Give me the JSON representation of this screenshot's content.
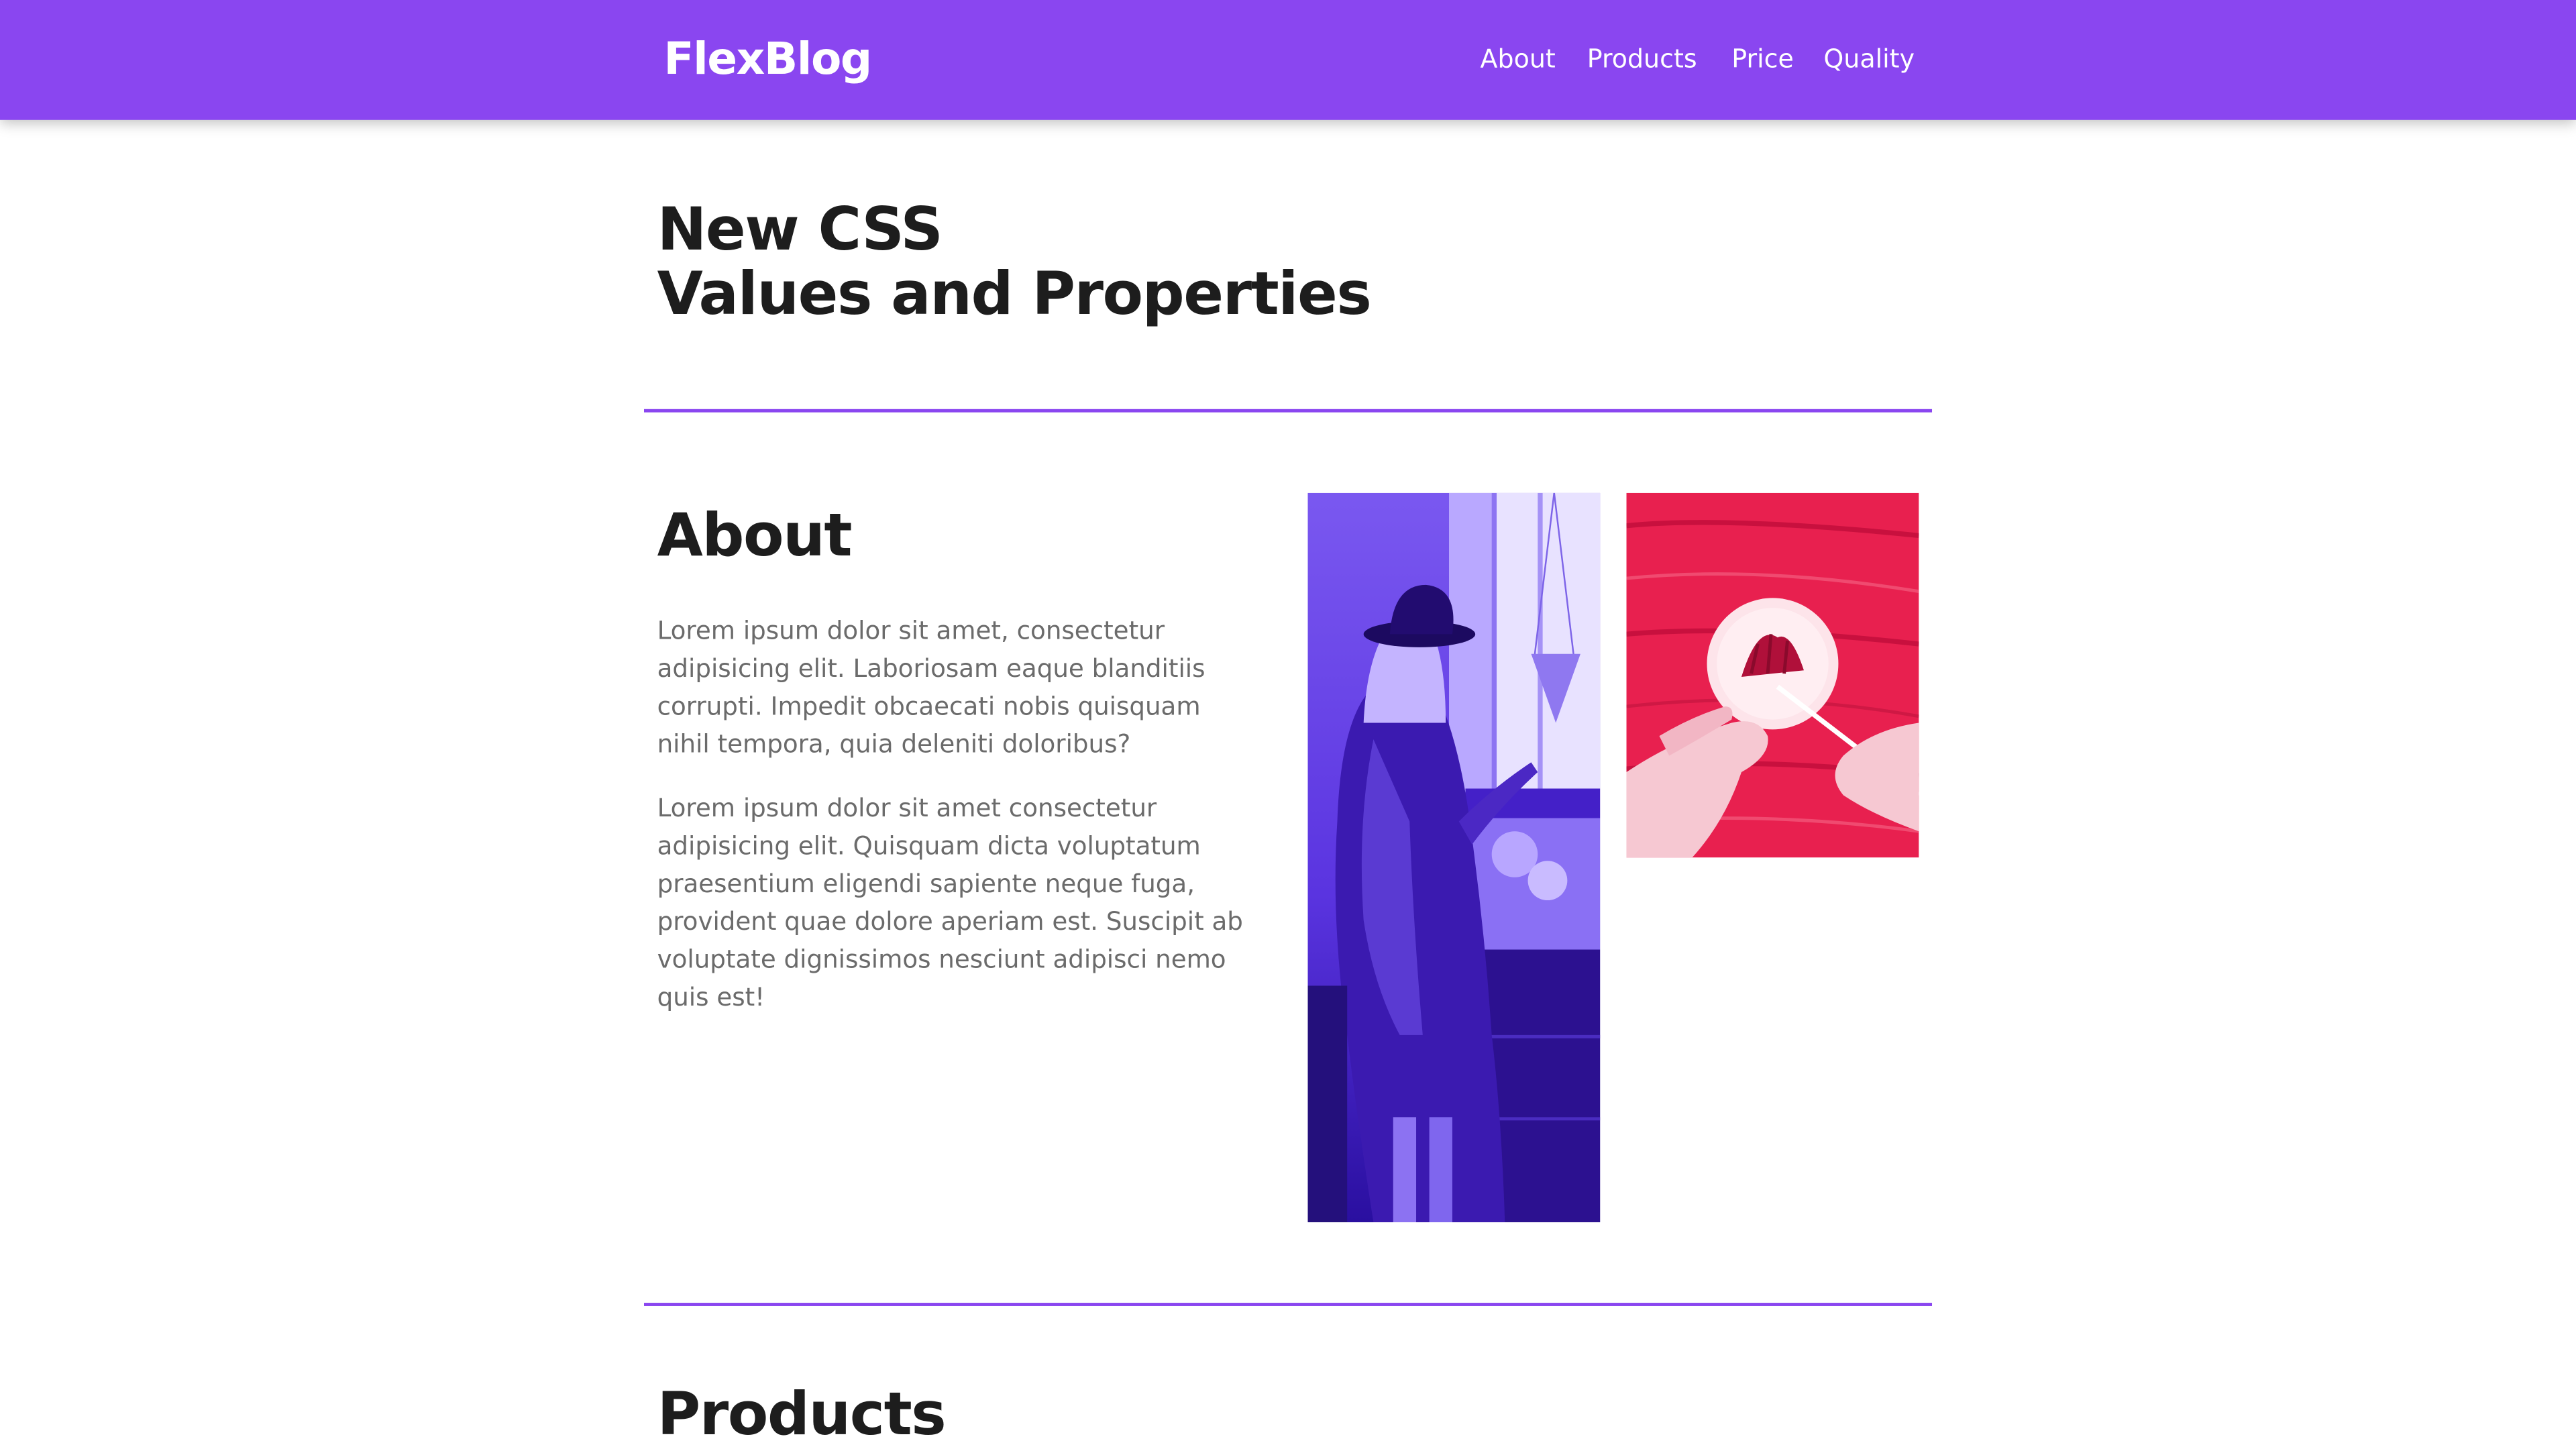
{
  "header": {
    "logo": "FlexBlog",
    "nav": [
      {
        "label": "About"
      },
      {
        "label": "Products"
      },
      {
        "label": "Price"
      },
      {
        "label": "Quality"
      }
    ]
  },
  "hero": {
    "title_line1": "New CSS",
    "title_line2": "Values and Properties"
  },
  "about": {
    "heading": "About",
    "paragraphs": [
      "Lorem ipsum dolor sit amet, consectetur adipisicing elit. Laboriosam eaque blanditiis corrupti. Impedit obcaecati nobis quisquam nihil tempora, quia deleniti doloribus?",
      "Lorem ipsum dolor sit amet consectetur adipisicing elit. Quisquam dicta voluptatum praesentium eligendi sapiente neque fuga, provident quae dolore aperiam est. Suscipit ab voluptate dignissimos nesciunt adipisci nemo quis est!"
    ]
  },
  "products": {
    "heading": "Products"
  },
  "colors": {
    "accent": "#8a46f0",
    "heading": "#1d1d1d",
    "body_text": "#6b6b6b",
    "photo_purple": "#5b2ee0",
    "photo_red": "#e8204f"
  }
}
